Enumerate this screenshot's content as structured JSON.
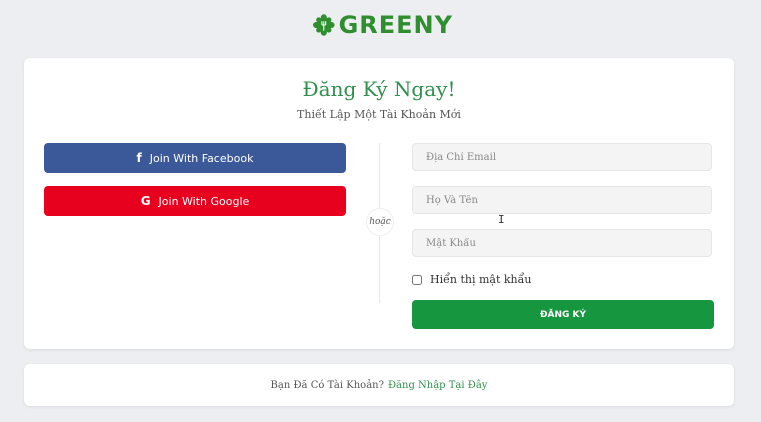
{
  "brand": {
    "name": "GREENY",
    "color": "#2f8f2f"
  },
  "register": {
    "title": "Đăng Ký Ngay!",
    "subtitle": "Thiết Lập Một Tài Khoản Mới",
    "facebook_label": "Join With Facebook",
    "google_label": "Join With Google",
    "or_label": "hoặc",
    "email_placeholder": "Địa Chỉ Email",
    "name_placeholder": "Họ Và Tên",
    "password_placeholder": "Mật Khẩu",
    "show_password_label": "Hiển thị mật khẩu",
    "submit_label": "ĐĂNG KÝ"
  },
  "footer": {
    "text": "Bạn Đã Có Tài Khoản?",
    "link": "Đăng Nhập Tại Đây"
  },
  "colors": {
    "facebook": "#3b5998",
    "google": "#e8001f",
    "primary": "#16963f",
    "title": "#2f8f4e"
  },
  "icons": [
    "logo-leaf-icon",
    "facebook-icon",
    "google-icon",
    "text-cursor-icon"
  ]
}
